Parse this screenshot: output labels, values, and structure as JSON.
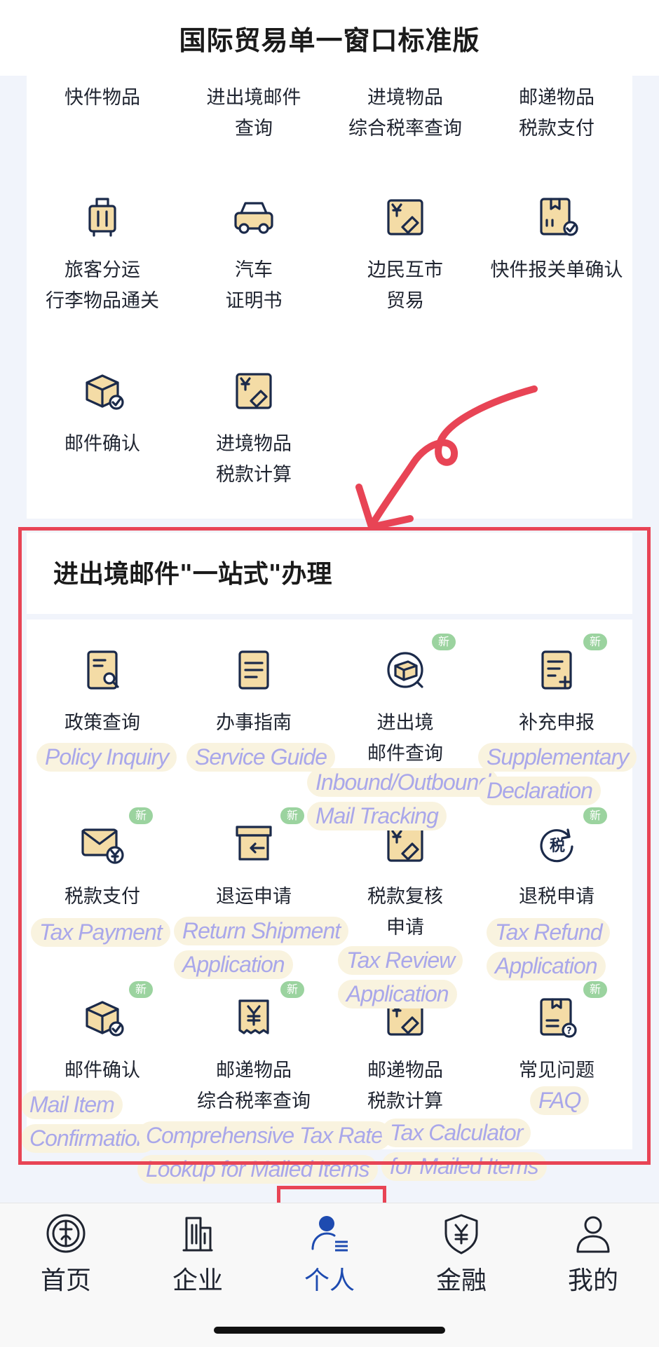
{
  "header": {
    "title": "国际贸易单一窗口标准版"
  },
  "top_grid": [
    {
      "label": "快件物品",
      "icon": "express-goods-icon"
    },
    {
      "label": "进出境邮件\n查询",
      "icon": "mail-query-icon"
    },
    {
      "label": "进境物品\n综合税率查询",
      "icon": "tax-rate-icon"
    },
    {
      "label": "邮递物品\n税款支付",
      "icon": "postal-tax-icon"
    },
    {
      "label": "旅客分运\n行李物品通关",
      "icon": "luggage-icon"
    },
    {
      "label": "汽车\n证明书",
      "icon": "car-icon"
    },
    {
      "label": "边民互市\n贸易",
      "icon": "border-trade-icon"
    },
    {
      "label": "快件报关单确认",
      "icon": "express-declaration-icon"
    },
    {
      "label": "邮件确认",
      "icon": "mail-confirm-icon"
    },
    {
      "label": "进境物品\n税款计算",
      "icon": "tax-calc-icon"
    }
  ],
  "section": {
    "title": "进出境邮件\"一站式\"办理",
    "badge_label": "新",
    "items": [
      {
        "label": "政策查询",
        "icon": "policy-search-icon",
        "is_new": false,
        "en": "Policy Inquiry"
      },
      {
        "label": "办事指南",
        "icon": "service-guide-icon",
        "is_new": false,
        "en": "Service Guide"
      },
      {
        "label": "进出境\n邮件查询",
        "icon": "mail-tracking-icon",
        "is_new": true,
        "en": "Inbound/Outbound\nMail Tracking"
      },
      {
        "label": "补充申报",
        "icon": "supplementary-icon",
        "is_new": true,
        "en": "Supplementary\nDeclaration"
      },
      {
        "label": "税款支付",
        "icon": "tax-payment-icon",
        "is_new": true,
        "en": "Tax Payment"
      },
      {
        "label": "退运申请",
        "icon": "return-shipment-icon",
        "is_new": true,
        "en": "Return Shipment\nApplication"
      },
      {
        "label": "税款复核\n申请",
        "icon": "tax-review-icon",
        "is_new": false,
        "en": "Tax Review\nApplication"
      },
      {
        "label": "退税申请",
        "icon": "tax-refund-icon",
        "is_new": true,
        "en": "Tax Refund\nApplication"
      },
      {
        "label": "邮件确认",
        "icon": "mail-item-confirm-icon",
        "is_new": true,
        "en": "Mail Item\nConfirmation"
      },
      {
        "label": "邮递物品\n综合税率查询",
        "icon": "comprehensive-rate-icon",
        "is_new": true,
        "en": "Comprehensive Tax Rate\nLookup for Mailed Items"
      },
      {
        "label": "邮递物品\n税款计算",
        "icon": "tax-calculator-icon",
        "is_new": false,
        "en": "Tax Calculator\nfor Mailed Items"
      },
      {
        "label": "常见问题",
        "icon": "faq-icon",
        "is_new": true,
        "en": "FAQ"
      }
    ]
  },
  "tabs": [
    {
      "label": "首页",
      "icon": "customs-emblem-icon",
      "active": false
    },
    {
      "label": "企业",
      "icon": "building-icon",
      "active": false
    },
    {
      "label": "个人",
      "icon": "person-list-icon",
      "active": true
    },
    {
      "label": "金融",
      "icon": "yuan-shield-icon",
      "active": false
    },
    {
      "label": "我的",
      "icon": "user-icon",
      "active": false
    }
  ],
  "colors": {
    "accent": "#1e4bb0",
    "highlight_red": "#e84455",
    "new_badge": "#9bd39f",
    "translation_text": "#a9a7ea"
  }
}
